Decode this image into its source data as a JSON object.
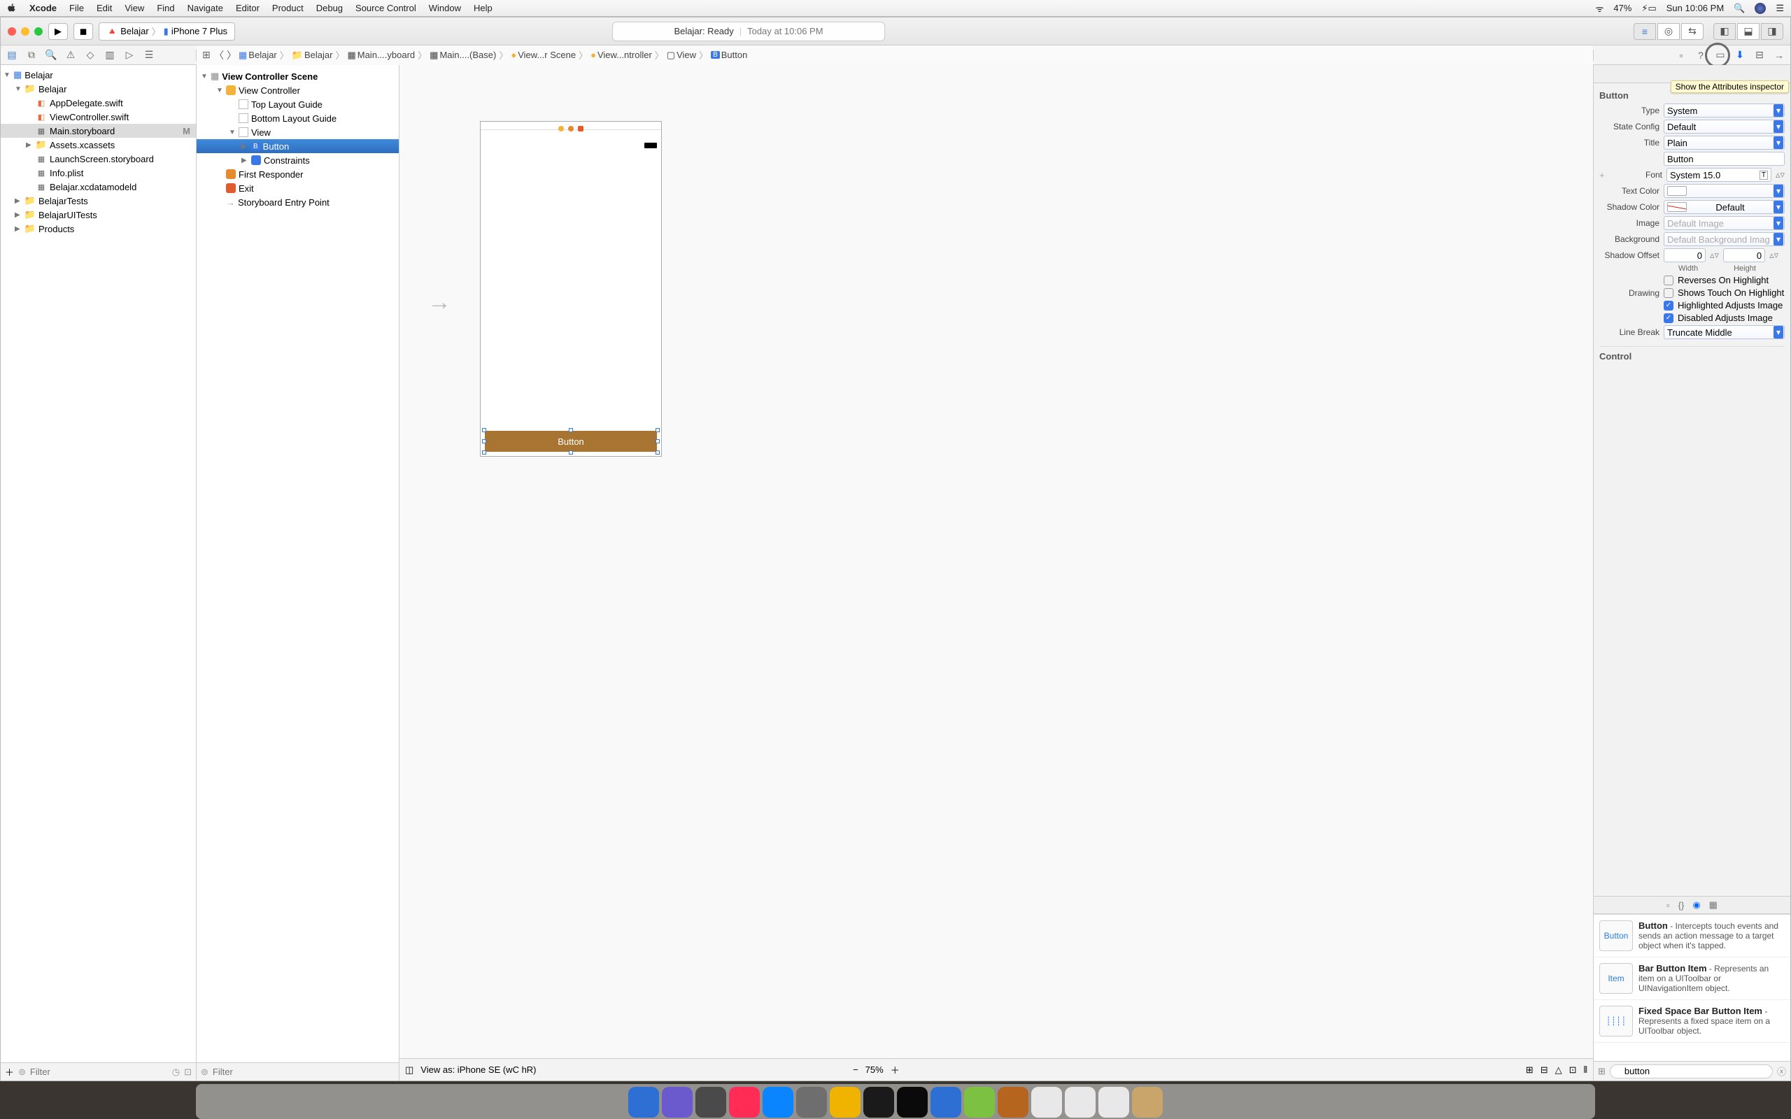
{
  "menubar": {
    "items": [
      "Xcode",
      "File",
      "Edit",
      "View",
      "Find",
      "Navigate",
      "Editor",
      "Product",
      "Debug",
      "Source Control",
      "Window",
      "Help"
    ],
    "battery": "47%",
    "clock": "Sun 10:06 PM"
  },
  "titlebar": {
    "scheme_app": "Belajar",
    "scheme_device": "iPhone 7 Plus",
    "status_left": "Belajar: Ready",
    "status_right": "Today at 10:06 PM"
  },
  "navigator": {
    "project": "Belajar",
    "items": [
      {
        "label": "Belajar",
        "depth": 1,
        "type": "folder",
        "open": true
      },
      {
        "label": "AppDelegate.swift",
        "depth": 2,
        "type": "swift"
      },
      {
        "label": "ViewController.swift",
        "depth": 2,
        "type": "swift"
      },
      {
        "label": "Main.storyboard",
        "depth": 2,
        "type": "sb",
        "selected": true,
        "badge": "M"
      },
      {
        "label": "Assets.xcassets",
        "depth": 2,
        "type": "folder"
      },
      {
        "label": "LaunchScreen.storyboard",
        "depth": 2,
        "type": "sb"
      },
      {
        "label": "Info.plist",
        "depth": 2,
        "type": "sb"
      },
      {
        "label": "Belajar.xcdatamodeld",
        "depth": 2,
        "type": "sb"
      },
      {
        "label": "BelajarTests",
        "depth": 1,
        "type": "folder"
      },
      {
        "label": "BelajarUITests",
        "depth": 1,
        "type": "folder"
      },
      {
        "label": "Products",
        "depth": 1,
        "type": "folder"
      }
    ],
    "filter_placeholder": "Filter"
  },
  "jumpbar": [
    "Belajar",
    "Belajar",
    "Main....yboard",
    "Main....(Base)",
    "View...r Scene",
    "View...ntroller",
    "View",
    "Button"
  ],
  "outline": {
    "title": "View Controller Scene",
    "items": [
      {
        "label": "View Controller",
        "depth": 1,
        "disc": "▼",
        "color": "#f3b23a"
      },
      {
        "label": "Top Layout Guide",
        "depth": 2
      },
      {
        "label": "Bottom Layout Guide",
        "depth": 2
      },
      {
        "label": "View",
        "depth": 2,
        "disc": "▼"
      },
      {
        "label": "Button",
        "depth": 3,
        "disc": "▶",
        "selected": true,
        "iconletter": "B"
      },
      {
        "label": "Constraints",
        "depth": 3,
        "disc": "▶",
        "color": "#3a78e8"
      },
      {
        "label": "First Responder",
        "depth": 1,
        "color": "#e68a2e"
      },
      {
        "label": "Exit",
        "depth": 1,
        "color": "#e05b2e"
      },
      {
        "label": "Storyboard Entry Point",
        "depth": 1,
        "arrow": true
      }
    ],
    "filter_placeholder": "Filter"
  },
  "canvas": {
    "button_text": "Button",
    "viewas": "View as: iPhone SE (wC hR)",
    "zoom": "75%"
  },
  "inspector": {
    "header": "Button",
    "callout": "Show the Attributes inspector",
    "type_label": "Type",
    "type_value": "System",
    "state_label": "State Config",
    "state_value": "Default",
    "titlemode_label": "Title",
    "titlemode_value": "Plain",
    "title_value": "Button",
    "font_label": "Font",
    "font_value": "System 15.0",
    "textcolor_label": "Text Color",
    "shadowcolor_label": "Shadow Color",
    "shadowcolor_value": "Default",
    "image_label": "Image",
    "image_ph": "Default Image",
    "bg_label": "Background",
    "bg_ph": "Default Background Imag",
    "offset_label": "Shadow Offset",
    "offset_w": "0",
    "offset_h": "0",
    "offset_wl": "Width",
    "offset_hl": "Height",
    "chk1": "Reverses On Highlight",
    "drawing_label": "Drawing",
    "chk2": "Shows Touch On Highlight",
    "chk3": "Highlighted Adjusts Image",
    "chk4": "Disabled Adjusts Image",
    "linebreak_label": "Line Break",
    "linebreak_value": "Truncate Middle",
    "control_header": "Control"
  },
  "library": {
    "items": [
      {
        "icon": "Button",
        "title": "Button",
        "desc": " - Intercepts touch events and sends an action message to a target object when it's tapped."
      },
      {
        "icon": "Item",
        "title": "Bar Button Item",
        "desc": " - Represents an item on a UIToolbar or UINavigationItem object."
      },
      {
        "icon": "┊┊┊┊",
        "title": "Fixed Space Bar Button Item",
        "desc": " - Represents a fixed space item on a UIToolbar object."
      }
    ],
    "search_value": "button"
  },
  "dock_colors": [
    "#2e6fd4",
    "#6a5acd",
    "#4a4a4a",
    "#ff2d55",
    "#0a84ff",
    "#6e6e6e",
    "#f0b400",
    "#1a1a1a",
    "#0a0a0a",
    "#2e6fd4",
    "#7cc141",
    "#b5651d",
    "#e8e8e8",
    "#e8e8e8",
    "#e8e8e8",
    "#c9a46b"
  ]
}
